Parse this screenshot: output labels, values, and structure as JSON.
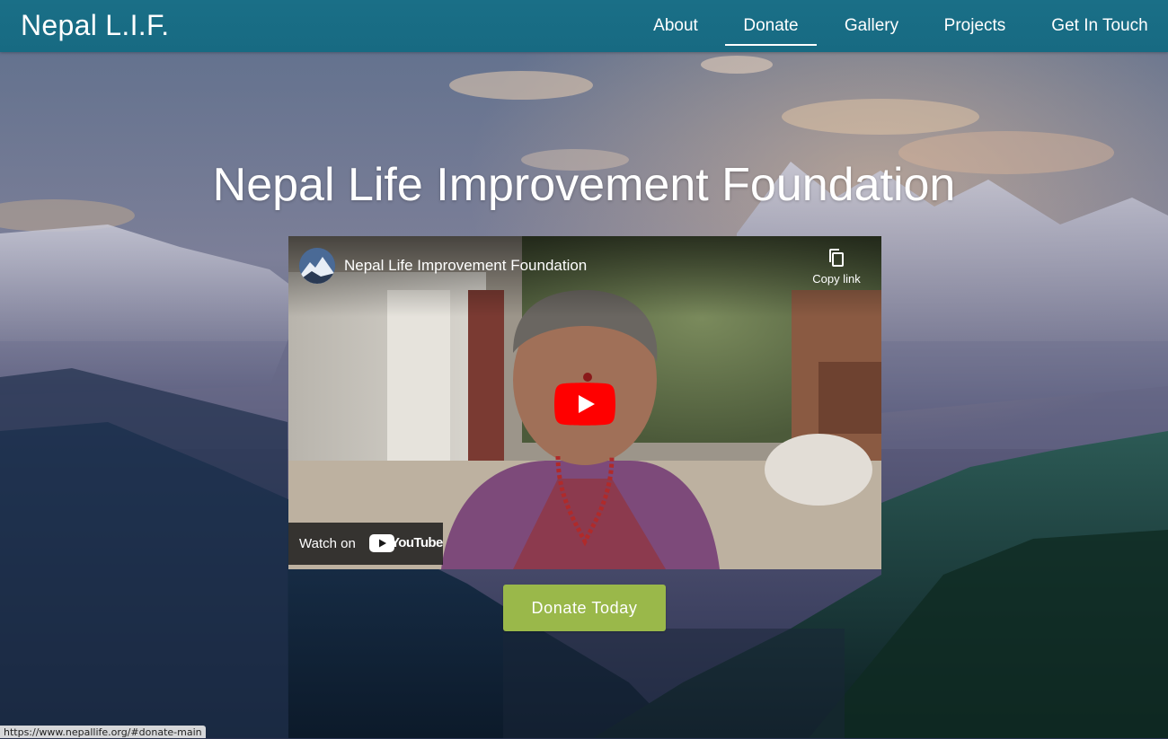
{
  "header": {
    "brand": "Nepal L.I.F.",
    "nav": [
      {
        "label": "About"
      },
      {
        "label": "Donate",
        "active": true
      },
      {
        "label": "Gallery"
      },
      {
        "label": "Projects"
      },
      {
        "label": "Get In Touch"
      }
    ],
    "bar_color": "#1a6f87"
  },
  "hero": {
    "title": "Nepal Life Improvement Foundation"
  },
  "video": {
    "title": "Nepal Life Improvement Foundation",
    "copy_label": "Copy link",
    "watch_label": "Watch on",
    "platform_label": "YouTube",
    "avatar_icon": "mountain-avatar",
    "play_color": "#ff0000"
  },
  "cta": {
    "label": "Donate Today",
    "color": "#9ab84a"
  },
  "status_bar": {
    "url": "https://www.nepallife.org/#donate-main"
  }
}
